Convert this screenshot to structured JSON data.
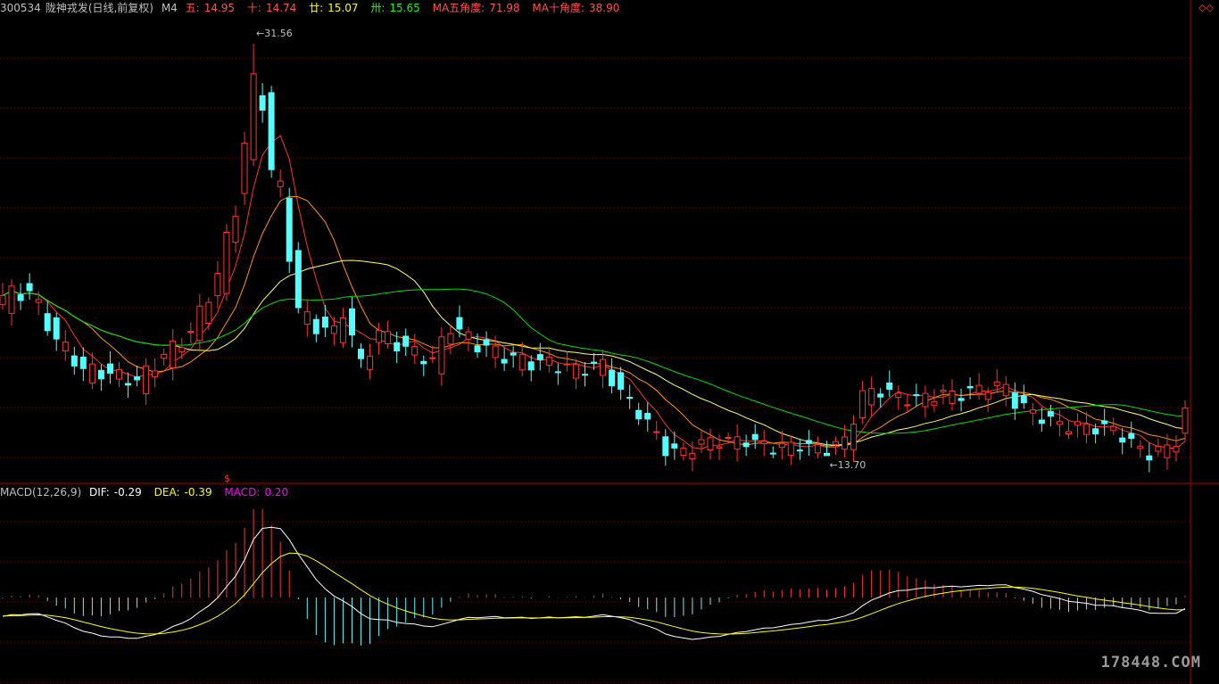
{
  "header": {
    "code": "300534",
    "title": "陇神戎发(日线,前复权)",
    "mode": "M4",
    "ma_values": [
      {
        "label": "五:",
        "value": "14.95"
      },
      {
        "label": "十:",
        "value": "14.74"
      },
      {
        "label": "廿:",
        "value": "15.07"
      },
      {
        "label": "卅:",
        "value": "15.65"
      }
    ],
    "angle1_label": "MA五角度:",
    "angle1_value": "71.98",
    "angle2_label": "MA十角度:",
    "angle2_value": "38.90",
    "corner_icons": "◇◇"
  },
  "macd_header": {
    "name": "MACD(12,26,9)",
    "dif_label": "DIF:",
    "dif_value": "-0.29",
    "dea_label": "DEA:",
    "dea_value": "-0.39",
    "macd_label": "MACD:",
    "macd_value": "0.20"
  },
  "watermark": "178448.COM",
  "chart_data": {
    "type": "candlestick",
    "price_range": [
      12.5,
      33.0
    ],
    "macd_range": [
      -2.6,
      2.9
    ],
    "annotations": [
      {
        "text": "31.56",
        "price": 31.56,
        "bar": 28
      },
      {
        "text": "13.70",
        "price": 13.7,
        "bar": 92
      }
    ],
    "signal_marker": {
      "text": "$",
      "bar": 25
    },
    "colors": {
      "up": "#ff3232",
      "down": "#54fcfc",
      "ma5": "#ff3232",
      "ma10": "#ff9600",
      "ma20": "#ffff64",
      "ma30": "#00e000",
      "dif": "#ffffff",
      "dea": "#ffff00",
      "grid": "#800000",
      "axis": "#b00000"
    }
  }
}
